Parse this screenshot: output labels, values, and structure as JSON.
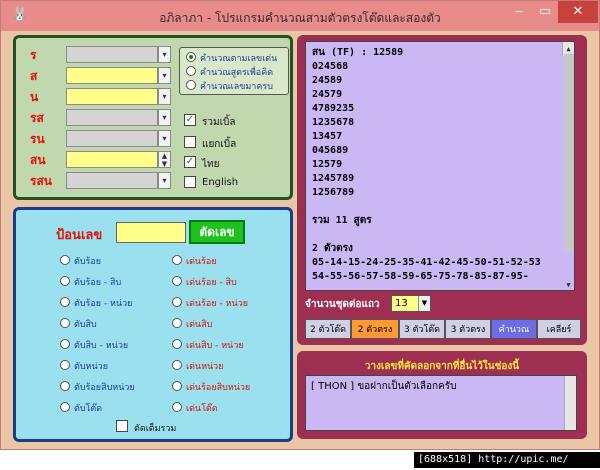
{
  "window": {
    "title": "อภิลาภา - โปรแกรมคำนวณสามตัวตรงโต๊ดและสองตัว",
    "icon": "app-rabbit-icon",
    "controls": {
      "minimize": "‒",
      "maximize": "▭",
      "close": "✕"
    }
  },
  "top_left": {
    "rows": [
      {
        "label": "ร",
        "value": "",
        "highlight": false,
        "btn": "▾"
      },
      {
        "label": "ส",
        "value": "",
        "highlight": true,
        "btn": "▾"
      },
      {
        "label": "น",
        "value": "",
        "highlight": true,
        "btn": "▾"
      },
      {
        "label": "รส",
        "value": "",
        "highlight": false,
        "btn": "▾"
      },
      {
        "label": "รน",
        "value": "",
        "highlight": false,
        "btn": "▾"
      },
      {
        "label": "สน",
        "value": "",
        "highlight": true,
        "btn": "spin"
      },
      {
        "label": "รสน",
        "value": "",
        "highlight": false,
        "btn": "▾"
      }
    ],
    "modes": [
      {
        "label": "คำนวณตามเลขเด่น",
        "selected": true
      },
      {
        "label": "คำนวณสูตรเพื่อคิด",
        "selected": false
      },
      {
        "label": "คำนวณเลขมาครบ",
        "selected": false
      }
    ],
    "checks": [
      {
        "label": "รวมเบิ้ล",
        "checked": true
      },
      {
        "label": "แยกเบิ้ล",
        "checked": false
      },
      {
        "label": "ไทย",
        "checked": true
      },
      {
        "label": "English",
        "checked": false
      }
    ]
  },
  "bottom_left": {
    "input_label": "ป้อนเลข",
    "input_value": "",
    "cut_button": "ตัดเลข",
    "left_options": [
      "ตับร้อย",
      "ตับร้อย - สิบ",
      "ตับร้อย - หน่วย",
      "ตับสิบ",
      "ตับสิบ - หน่วย",
      "ตับหน่วย",
      "ตับร้อยสิบหน่วย",
      "ตับโต๊ด"
    ],
    "right_options": [
      "เด่นร้อย",
      "เด่นร้อย - สิบ",
      "เด่นร้อย - หน่วย",
      "เด่นสิบ",
      "เด่นสิบ - หน่วย",
      "เด่นหน่วย",
      "เด่นร้อยสิบหน่วย",
      "เด่นโต๊ด"
    ],
    "bottom_check": "ตัดเต็มรวม"
  },
  "results": {
    "header": "สน (TF) : 12589",
    "lines": [
      "024568",
      "24589",
      "24579",
      "4789235",
      "1235678",
      "13457",
      "045689",
      "12579",
      "1245789",
      "1256789"
    ],
    "total": "รวม 11 สูตร",
    "two_digit_title": "2 ตัวตรง",
    "two_digit_line1": "05-14-15-24-25-35-41-42-45-50-51-52-53",
    "two_digit_line2": "54-55-56-57-58-59-65-75-78-85-87-95-"
  },
  "controls": {
    "per_row_label": "จำนวนชุดต่อแถว",
    "per_row_value": "13",
    "tabs": [
      {
        "label": "2 ตัวโต๊ด",
        "color": "#cfcfe6",
        "text": "#000000"
      },
      {
        "label": "2 ตัวตรง",
        "color": "#ff9933",
        "text": "#000000"
      },
      {
        "label": "3 ตัวโต๊ด",
        "color": "#cfcfe6",
        "text": "#000000"
      },
      {
        "label": "3 ตัวตรง",
        "color": "#cfcfe6",
        "text": "#000000"
      },
      {
        "label": "คำนวณ",
        "color": "#6c6ce6",
        "text": "#ffffff"
      },
      {
        "label": "เคลียร์",
        "color": "#cfcfe6",
        "text": "#000000"
      }
    ]
  },
  "note": {
    "title": "วางเลขที่คัดลอกจากที่อื่นไว้ในช่องนี้",
    "text": "[ THON ] ขอฝากเป็นตัวเลือกครับ"
  },
  "watermark": "[688x518] http://upic.me/"
}
